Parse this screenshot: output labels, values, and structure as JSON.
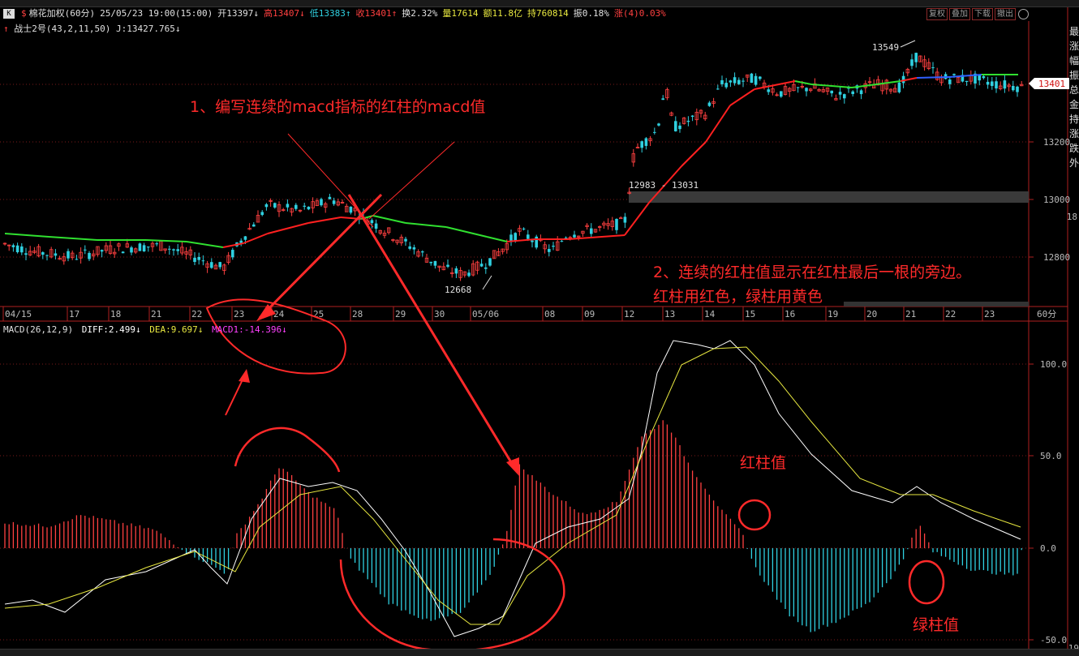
{
  "header": {
    "k_icon": "K",
    "title": "棉花加权(60分)",
    "datetime": "25/05/23 19:00(15:00)",
    "open": "开13397↓",
    "high": "高13407↓",
    "low": "低13383↑",
    "close": "收13401↑",
    "turnover": "换2.32%",
    "volume": "量17614",
    "amount": "额11.8亿",
    "hold": "持760814",
    "amplitude": "振0.18%",
    "change": "涨(4)0.03%",
    "buttons": [
      "复权",
      "叠加",
      "下载",
      "撤出"
    ]
  },
  "indicator2": {
    "arrow": "↑",
    "name": "战士2号(43,2,11,50)",
    "value": "J:13427.765↓"
  },
  "price_axis": {
    "ticks": [
      "13200",
      "13000",
      "12800"
    ],
    "last_price": "13401",
    "right_edge_labels": [
      "18",
      "19"
    ]
  },
  "date_axis": {
    "labels": [
      "04/15",
      "17",
      "18",
      "21",
      "22",
      "23",
      "24",
      "25",
      "28",
      "29",
      "30",
      "05/06",
      "08",
      "09",
      "12",
      "13",
      "14",
      "15",
      "16",
      "19",
      "20",
      "21",
      "22",
      "23"
    ],
    "period": "60分"
  },
  "price_annotations": {
    "high_mark": "13549",
    "low_mark": "12668",
    "gap": "12983 - 13031"
  },
  "macd_header": {
    "name": "MACD(26,12,9)",
    "diff": "DIFF:2.499↓",
    "dea": "DEA:9.697↓",
    "macd1": "MACD1:-14.396↓"
  },
  "macd_axis": {
    "ticks": [
      "100.0",
      "50.0",
      "0.0",
      "-50.0"
    ]
  },
  "right_panel_chars": [
    "最",
    "涨",
    "幅",
    "振",
    "总",
    "金",
    "持",
    "涨",
    "跌",
    "外"
  ],
  "annotations": {
    "note1": "1、编写连续的macd指标的红柱的macd值",
    "note2_line1": "2、连续的红柱值显示在红柱最后一根的旁边。",
    "note2_line2": "红柱用红色，绿柱用黄色",
    "red_label": "红柱值",
    "green_label": "绿柱值"
  },
  "colors": {
    "up": "#ff4040",
    "down": "#2fd0e0",
    "ma_red": "#ff2020",
    "ma_green": "#30e030",
    "diff": "#ffffff",
    "dea": "#e8e840",
    "annot": "#ff2a2a"
  }
}
